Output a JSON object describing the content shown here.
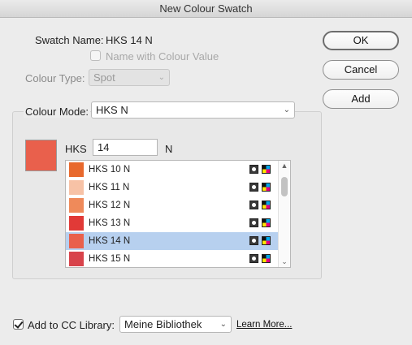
{
  "window": {
    "title": "New Colour Swatch"
  },
  "swatch_name": {
    "label": "Swatch Name:",
    "value": "HKS 14 N"
  },
  "name_with_value": {
    "label": "Name with Colour Value",
    "checked": false
  },
  "colour_type": {
    "label": "Colour Type:",
    "value": "Spot"
  },
  "colour_mode": {
    "label": "Colour Mode:",
    "value": "HKS N"
  },
  "buttons": {
    "ok": "OK",
    "cancel": "Cancel",
    "add": "Add"
  },
  "hks": {
    "label": "HKS",
    "value": "14",
    "suffix": "N",
    "current_color": "#e9604c"
  },
  "swatch_list": [
    {
      "name": "HKS 10 N",
      "color": "#e8692d",
      "selected": false
    },
    {
      "name": "HKS 11 N",
      "color": "#f7c2a6",
      "selected": false
    },
    {
      "name": "HKS 12 N",
      "color": "#ef8a5a",
      "selected": false
    },
    {
      "name": "HKS 13 N",
      "color": "#e13a37",
      "selected": false
    },
    {
      "name": "HKS 14 N",
      "color": "#e9604c",
      "selected": true
    },
    {
      "name": "HKS 15 N",
      "color": "#d8434b",
      "selected": false
    }
  ],
  "cc_library": {
    "label": "Add to CC Library:",
    "checked": true,
    "value": "Meine Bibliothek",
    "learn_more": "Learn More..."
  },
  "icons": {
    "spot": "spot-colour-icon",
    "process": "cmyk-process-icon",
    "chevron": "chevron-down-icon"
  }
}
